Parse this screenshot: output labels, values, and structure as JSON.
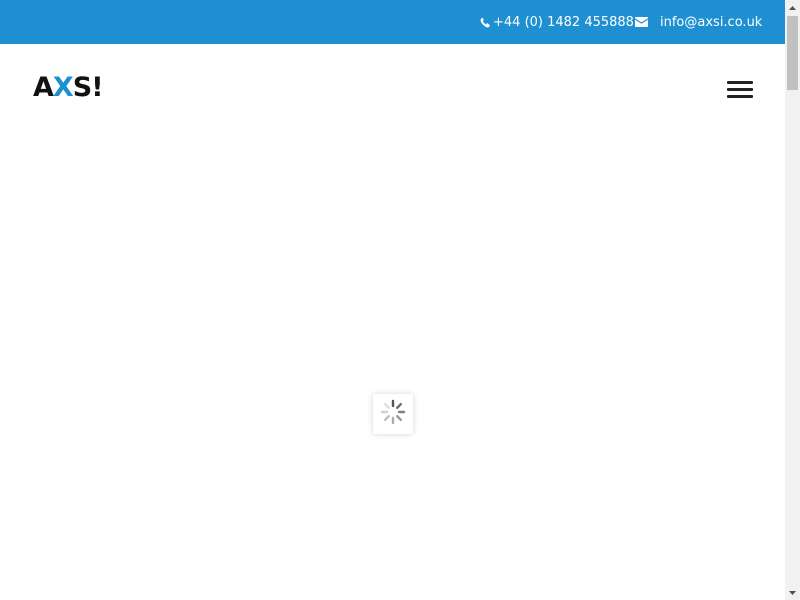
{
  "colors": {
    "topbar": "#1e90d2",
    "accent": "#1e90d2",
    "text_dark": "#111111",
    "menu_icon": "#222222"
  },
  "topbar": {
    "phone": {
      "icon": "phone-icon",
      "text": "+44 (0) 1482 455888"
    },
    "email": {
      "icon": "envelope-icon",
      "text": "info@axsi.co.uk"
    }
  },
  "header": {
    "logo": {
      "letters": [
        "A",
        "X",
        "S",
        "!"
      ]
    },
    "menu_icon": "hamburger-menu-icon"
  },
  "loader": {
    "icon": "spinner-icon"
  },
  "scrollbar": {
    "up_icon": "scroll-up-arrow-icon",
    "down_icon": "scroll-down-arrow-icon",
    "position": 0
  }
}
